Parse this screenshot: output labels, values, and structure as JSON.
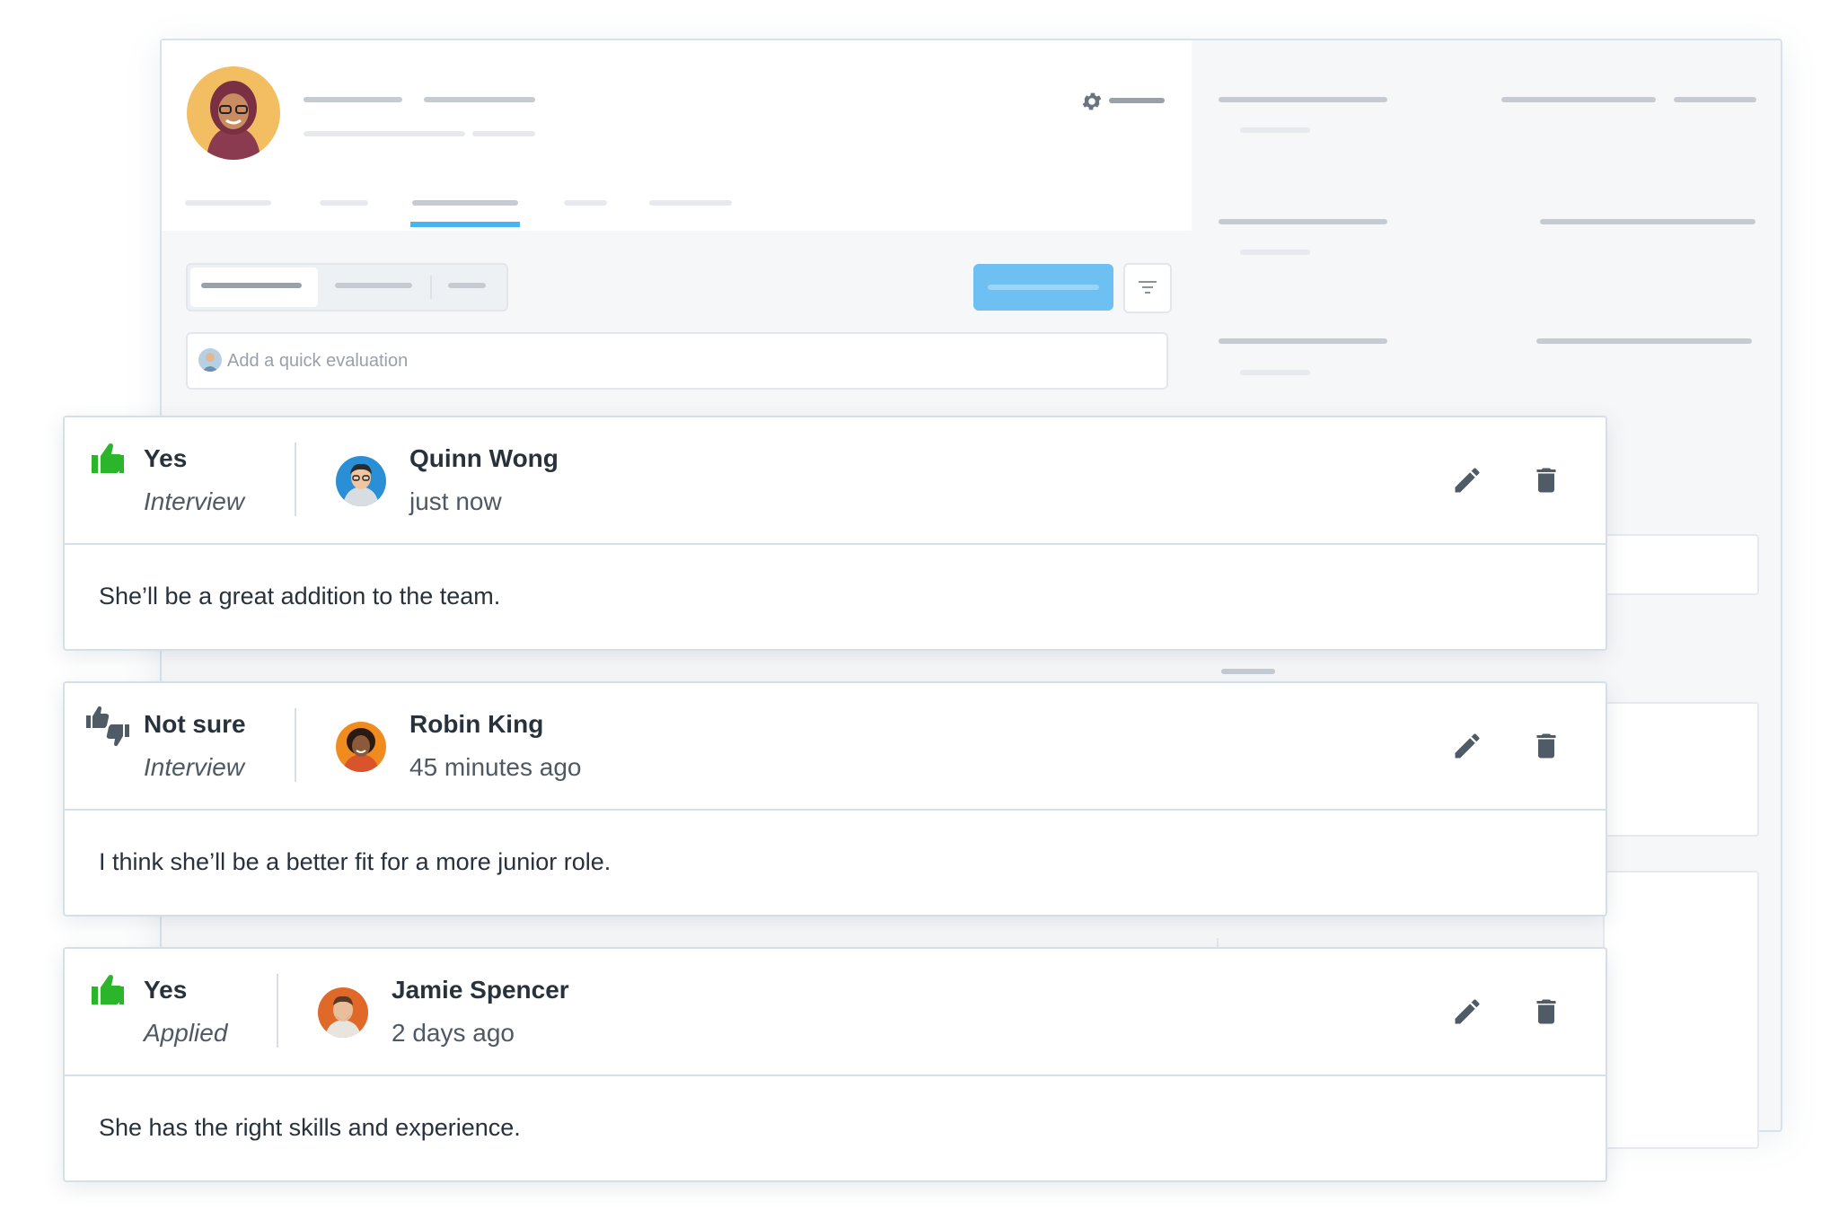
{
  "quick_evaluation": {
    "placeholder": "Add a quick evaluation"
  },
  "evaluations": [
    {
      "verdict": "Yes",
      "verdict_icon": "thumbs-up-icon",
      "verdict_color": "#2ab52a",
      "stage": "Interview",
      "author": "Quinn Wong",
      "time": "just now",
      "comment": "She’ll be a great addition to the team."
    },
    {
      "verdict": "Not sure",
      "verdict_icon": "thumbs-up-down-icon",
      "verdict_color": "#4f5b66",
      "stage": "Interview",
      "author": "Robin King",
      "time": "45 minutes ago",
      "comment": "I think she’ll be a better fit for a more junior role."
    },
    {
      "verdict": "Yes",
      "verdict_icon": "thumbs-up-icon",
      "verdict_color": "#2ab52a",
      "stage": "Applied",
      "author": "Jamie Spencer",
      "time": "2 days ago",
      "comment": "She has the right skills and experience."
    }
  ],
  "colors": {
    "accent": "#4ab4f0",
    "primary_button": "#6ec0f3",
    "positive": "#2ab52a",
    "icon_dark": "#4f5b66"
  }
}
